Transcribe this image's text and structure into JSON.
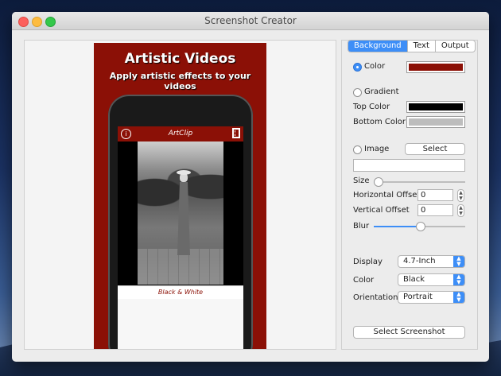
{
  "window": {
    "title": "Screenshot Creator"
  },
  "preview": {
    "headline": "Artistic Videos",
    "subheadline": "Apply artistic effects to your videos",
    "app_title": "ArtClip",
    "filter_caption": "Black & White",
    "background_color": "#8b1006"
  },
  "tabs": [
    {
      "label": "Background",
      "active": true
    },
    {
      "label": "Text",
      "active": false
    },
    {
      "label": "Output",
      "active": false
    }
  ],
  "background": {
    "color_label": "Color",
    "color_value": "#8b1006",
    "gradient_label": "Gradient",
    "top_color_label": "Top Color",
    "top_color_value": "#000000",
    "bottom_color_label": "Bottom Color",
    "bottom_color_value": "#bdbdbd",
    "image_label": "Image",
    "select_label": "Select",
    "image_path": "",
    "size_label": "Size",
    "size_level": 0.0,
    "horizontal_offset_label": "Horizontal Offset",
    "horizontal_offset_value": "0",
    "vertical_offset_label": "Vertical Offset",
    "vertical_offset_value": "0",
    "blur_label": "Blur",
    "blur_level": 0.5
  },
  "device": {
    "display_label": "Display",
    "display_value": "4.7-Inch",
    "color_label": "Color",
    "color_value": "Black",
    "orientation_label": "Orientation",
    "orientation_value": "Portrait"
  },
  "actions": {
    "select_screenshot_label": "Select Screenshot"
  }
}
